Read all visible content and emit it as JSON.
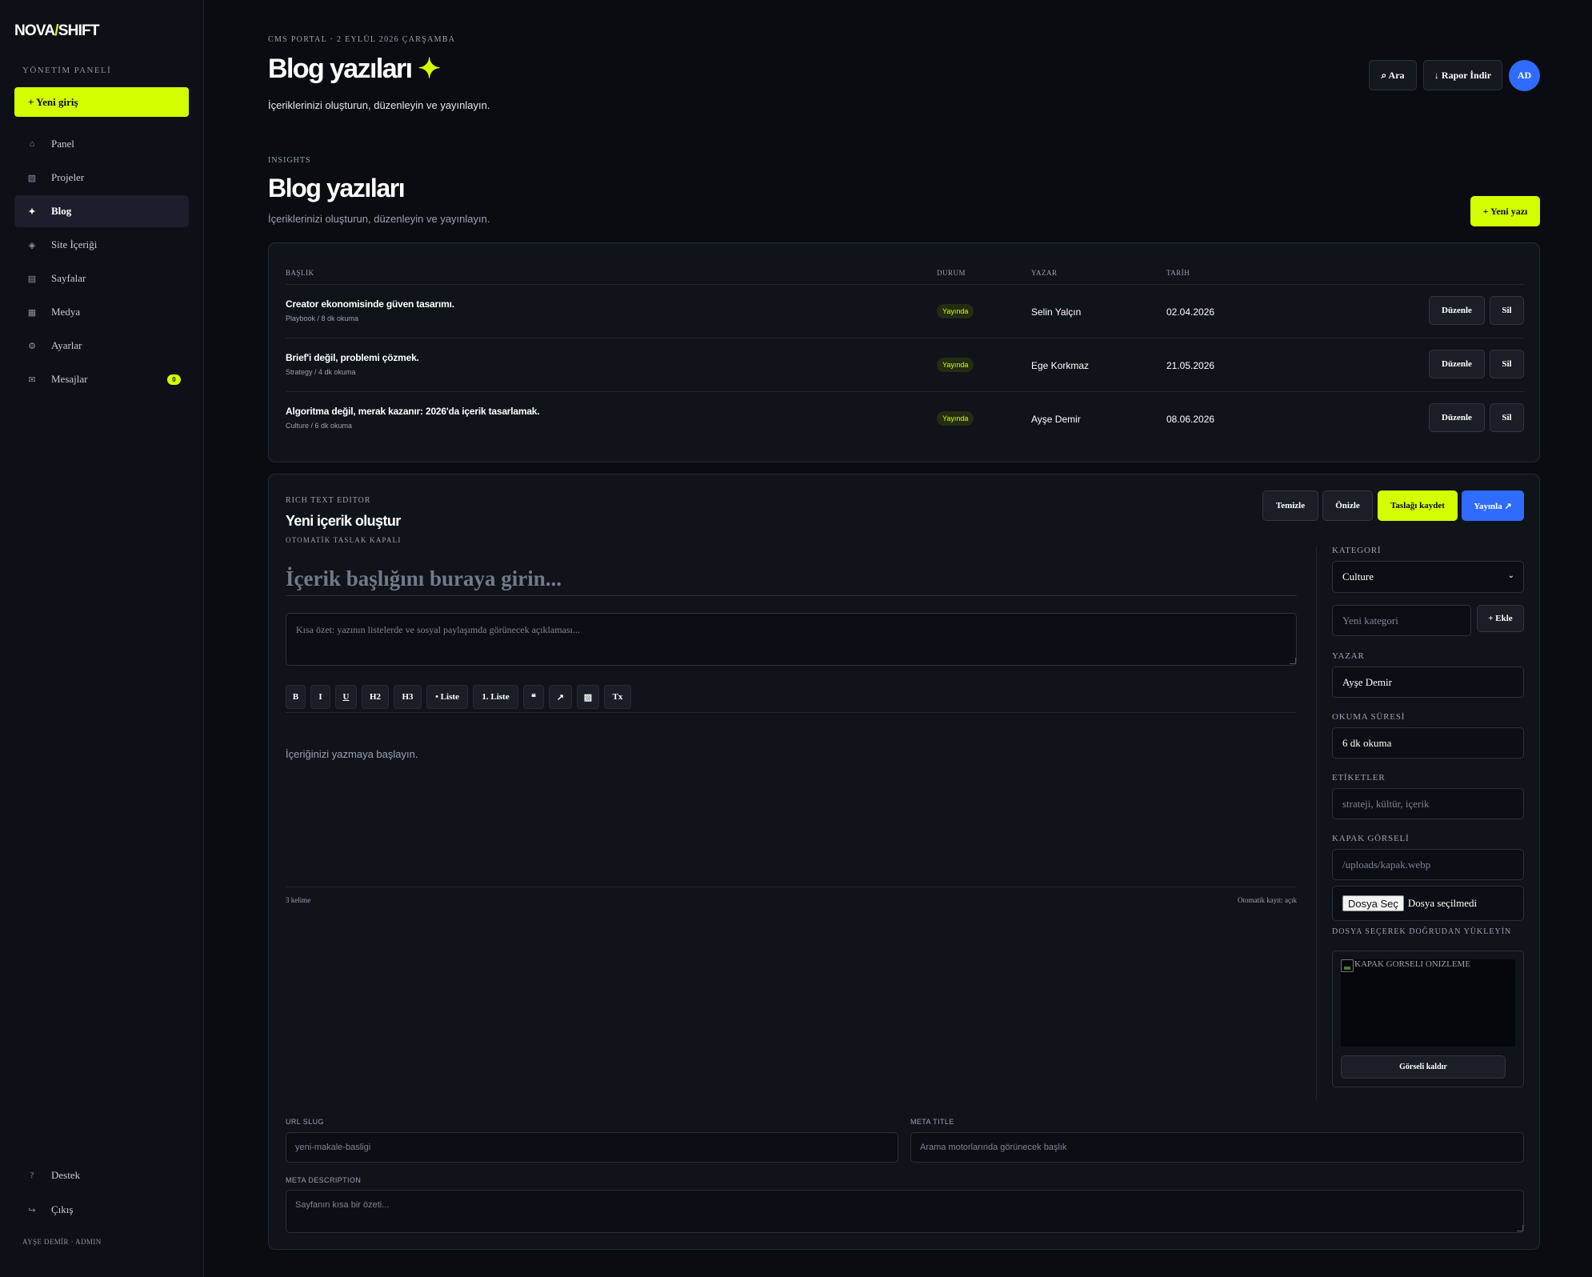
{
  "sidebar": {
    "logo_left": "NOVA",
    "logo_slash": "/",
    "logo_right": "SHIFT",
    "section_label": "YÖNETİM PANELİ",
    "new_entry_label": "+ Yeni giriş",
    "items": [
      {
        "label": "Panel",
        "icon": "⌂",
        "icon_name": "home-icon"
      },
      {
        "label": "Projeler",
        "icon": "▧",
        "icon_name": "projects-icon"
      },
      {
        "label": "Blog",
        "icon": "✦",
        "icon_name": "sparkle-icon",
        "active": true
      },
      {
        "label": "Site İçeriği",
        "icon": "◈",
        "icon_name": "diamond-icon"
      },
      {
        "label": "Sayfalar",
        "icon": "▤",
        "icon_name": "pages-icon"
      },
      {
        "label": "Medya",
        "icon": "▦",
        "icon_name": "media-icon"
      },
      {
        "label": "Ayarlar",
        "icon": "⚙",
        "icon_name": "gear-icon"
      },
      {
        "label": "Mesajlar",
        "icon": "✉",
        "icon_name": "mail-icon",
        "badge": "0"
      }
    ],
    "bottom": [
      {
        "label": "Destek",
        "icon": "?",
        "icon_name": "help-icon"
      },
      {
        "label": "Çıkış",
        "icon": "↪",
        "icon_name": "logout-icon"
      }
    ],
    "user": "AYŞE DEMİR · ADMIN"
  },
  "header": {
    "crumb": "CMS PORTAL · 2 EYLÜL 2026 ÇARŞAMBA",
    "title": "Blog yazıları",
    "title_icon": "✦",
    "subtitle": "İçeriklerinizi oluşturun, düzenleyin ve yayınlayın.",
    "search_label": "⌕ Ara",
    "report_label": "↓ Rapor İndir",
    "avatar": "AD"
  },
  "section": {
    "label": "INSIGHTS",
    "title": "Blog yazıları",
    "subtitle": "İçeriklerinizi oluşturun, düzenleyin ve yayınlayın.",
    "new_post_label": "+ Yeni yazı"
  },
  "table": {
    "headers": [
      "BAŞLIK",
      "DURUM",
      "YAZAR",
      "TARİH"
    ],
    "rows": [
      {
        "title": "Creator ekonomisinde güven tasarımı.",
        "meta": "Playbook / 8 dk okuma",
        "status": "Yayında",
        "author": "Selin Yalçın",
        "date": "02.04.2026"
      },
      {
        "title": "Brief'i değil, problemi çözmek.",
        "meta": "Strategy / 4 dk okuma",
        "status": "Yayında",
        "author": "Ege Korkmaz",
        "date": "21.05.2026"
      },
      {
        "title": "Algoritma değil, merak kazanır: 2026'da içerik tasarlamak.",
        "meta": "Culture / 6 dk okuma",
        "status": "Yayında",
        "author": "Ayşe Demir",
        "date": "08.06.2026"
      }
    ],
    "edit_label": "Düzenle",
    "delete_label": "Sil"
  },
  "editor": {
    "label": "RICH TEXT EDITOR",
    "title": "Yeni içerik oluştur",
    "autosave_state": "OTOMATİK TASLAK KAPALI",
    "actions": {
      "clear": "Temizle",
      "preview": "Önizle",
      "save_draft": "Taslağı kaydet",
      "publish": "Yayınla ↗"
    },
    "title_placeholder": "İçerik başlığını buraya girin...",
    "summary_placeholder": "Kısa özet: yazının listelerde ve sosyal paylaşımda görünecek açıklaması...",
    "toolbar": [
      "B",
      "I",
      "U",
      "H2",
      "H3",
      "• Liste",
      "1. Liste",
      "❝",
      "↗",
      "▨",
      "Tx"
    ],
    "content_placeholder": "İçeriğinizi yazmaya başlayın.",
    "word_count": "3 kelime",
    "autosave_footer": "Otomatik kayıt: açık",
    "sidebar": {
      "category_label": "KATEGORİ",
      "category_value": "Culture",
      "new_category_placeholder": "Yeni kategori",
      "add_label": "+ Ekle",
      "author_label": "YAZAR",
      "author_value": "Ayşe Demir",
      "reading_label": "OKUMA SÜRESİ",
      "reading_value": "6 dk okuma",
      "tags_label": "ETİKETLER",
      "tags_placeholder": "strateji, kültür, içerik",
      "cover_label": "KAPAK GÖRSELİ",
      "cover_placeholder": "/uploads/kapak.webp",
      "file_button": "Dosya Seç",
      "file_status": "Dosya seçilmedi",
      "file_hint": "DOSYA SEÇEREK DOĞRUDAN YÜKLEYİN",
      "preview_alt": "KAPAK GORSELI ONIZLEME",
      "remove_label": "Görseli kaldır"
    },
    "seo": {
      "slug_label": "URL SLUG",
      "slug_placeholder": "yeni-makale-basligi",
      "meta_title_label": "META TITLE",
      "meta_title_placeholder": "Arama motorlarında görünecek başlık",
      "meta_desc_label": "META DESCRIPTION",
      "meta_desc_placeholder": "Sayfanın kısa bir özeti..."
    }
  },
  "colors": {
    "accent": "#d4ff00",
    "primary": "#2f6bff",
    "background": "#0a0c11",
    "surface": "#0f131a"
  }
}
